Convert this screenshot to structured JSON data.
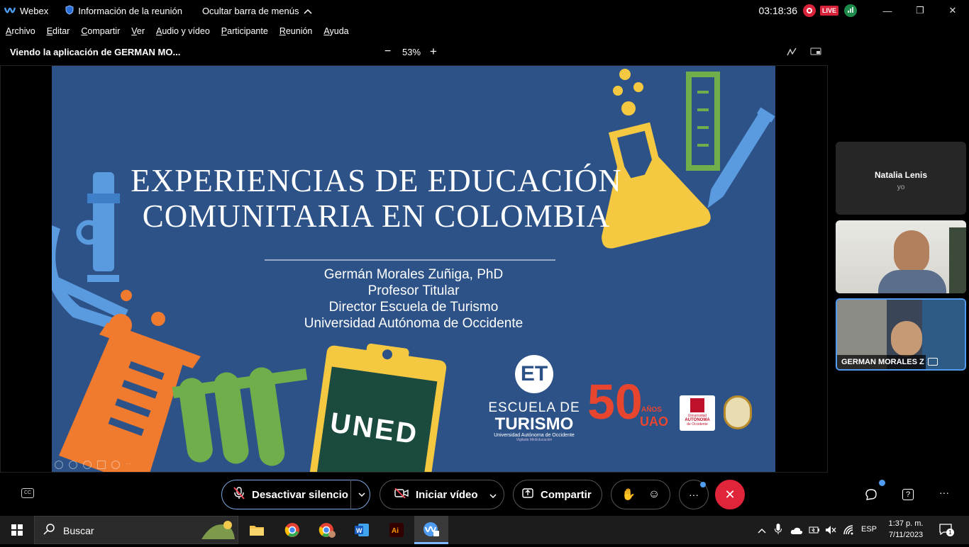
{
  "titlebar": {
    "app_name": "Webex",
    "meeting_info": "Información de la reunión",
    "hide_menu": "Ocultar barra de menús",
    "clock": "03:18:36",
    "live_badge": "LIVE"
  },
  "menu": [
    "Archivo",
    "Editar",
    "Compartir",
    "Ver",
    "Audio y vídeo",
    "Participante",
    "Reunión",
    "Ayuda"
  ],
  "sharebar": {
    "viewing": "Viendo la aplicación de GERMAN MO...",
    "zoom": "53%",
    "zoom_minus": "−",
    "zoom_plus": "+"
  },
  "slide": {
    "title_line1": "EXPERIENCIAS DE EDUCACIÓN",
    "title_line2": "COMUNITARIA EN COLOMBIA",
    "author": "Germán Morales Zuñiga, PhD",
    "role1": "Profesor Titular",
    "role2": "Director Escuela de Turismo",
    "university": "Universidad Autónoma de Occidente",
    "board_text": "UNED",
    "logo_et": "ET",
    "logo_escuela": "ESCUELA DE",
    "logo_turismo": "TURISMO",
    "logo_uao_sub": "Universidad Autónoma de Occidente",
    "logo_vigilada": "Vigilada MinEducación",
    "logo_50": "50",
    "logo_anos": "AÑOS",
    "logo_uao": "UAO",
    "logo_uni_small1": "Universidad",
    "logo_uni_small2": "AUTÓNOMA",
    "logo_uni_small3": "de Occidente"
  },
  "participants": {
    "self_name": "Natalia Lenis",
    "self_label": "yo",
    "speaker_name": "GERMAN MORALES Z"
  },
  "controls": {
    "mute_label": "Desactivar silencio",
    "video_label": "Iniciar vídeo",
    "share_label": "Compartir",
    "more": "···"
  },
  "taskbar": {
    "search": "Buscar",
    "lang": "ESP",
    "time": "1:37 p. m.",
    "date": "7/11/2023",
    "notif_count": "1"
  },
  "colors": {
    "slide_bg": "#2d5287",
    "leave_red": "#e0243a",
    "accent_blue": "#4f9cf0"
  }
}
